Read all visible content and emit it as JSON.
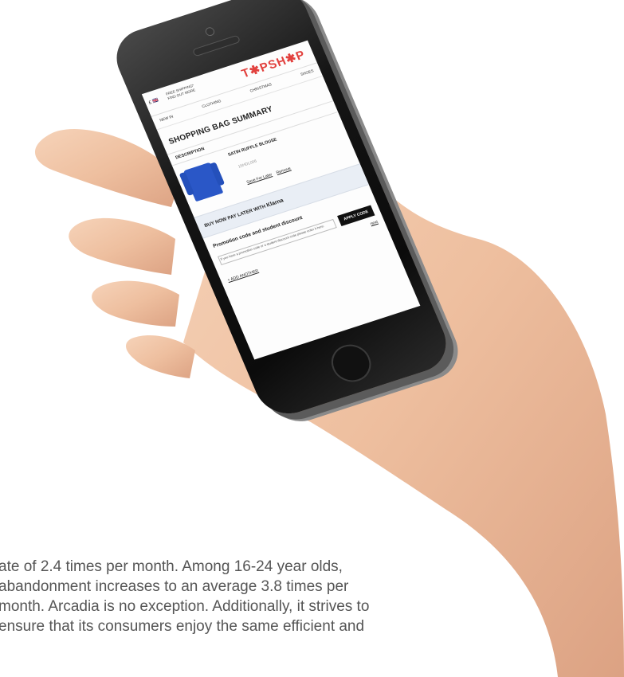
{
  "phone_screen": {
    "flag": "£ 🇬🇧",
    "promo_line1": "FREE SHIPPING*",
    "promo_line2": "FIND OUT MORE",
    "logo": "T✱PSH✱P",
    "nav": [
      "NEW IN",
      "CLOTHING",
      "CHRISTMAS",
      "SHOES"
    ],
    "title": "SHOPPING BAG SUMMARY",
    "description_header": "DESCRIPTION",
    "product": {
      "name": "SATIN RUFFLE BLOUSE",
      "size": "15HDL006",
      "save_for_later": "Save For Later",
      "remove": "Remove"
    },
    "klarna": {
      "text": "BUY NOW PAY LATER WITH",
      "brand": "Klarna"
    },
    "promo_code": {
      "title": "Promotion code and student discount",
      "hint": "If you have a promotion code or a student discount code please enter it here:",
      "apply_label": "APPLY CODE",
      "next_label": "next",
      "add_another": "+ ADD ANOTHER"
    }
  },
  "paragraph": {
    "lines": [
      "ate of 2.4 times per month. Among 16-24 year olds,",
      "abandonment increases to an average 3.8 times per",
      "month. Arcadia is no exception. Additionally, it strives to",
      "ensure that its consumers enjoy the same efficient and"
    ]
  },
  "colors": {
    "logo": "#e2413e",
    "text": "#555555",
    "klarna_band": "#e9eef5",
    "skin": "#f0c7a8"
  }
}
